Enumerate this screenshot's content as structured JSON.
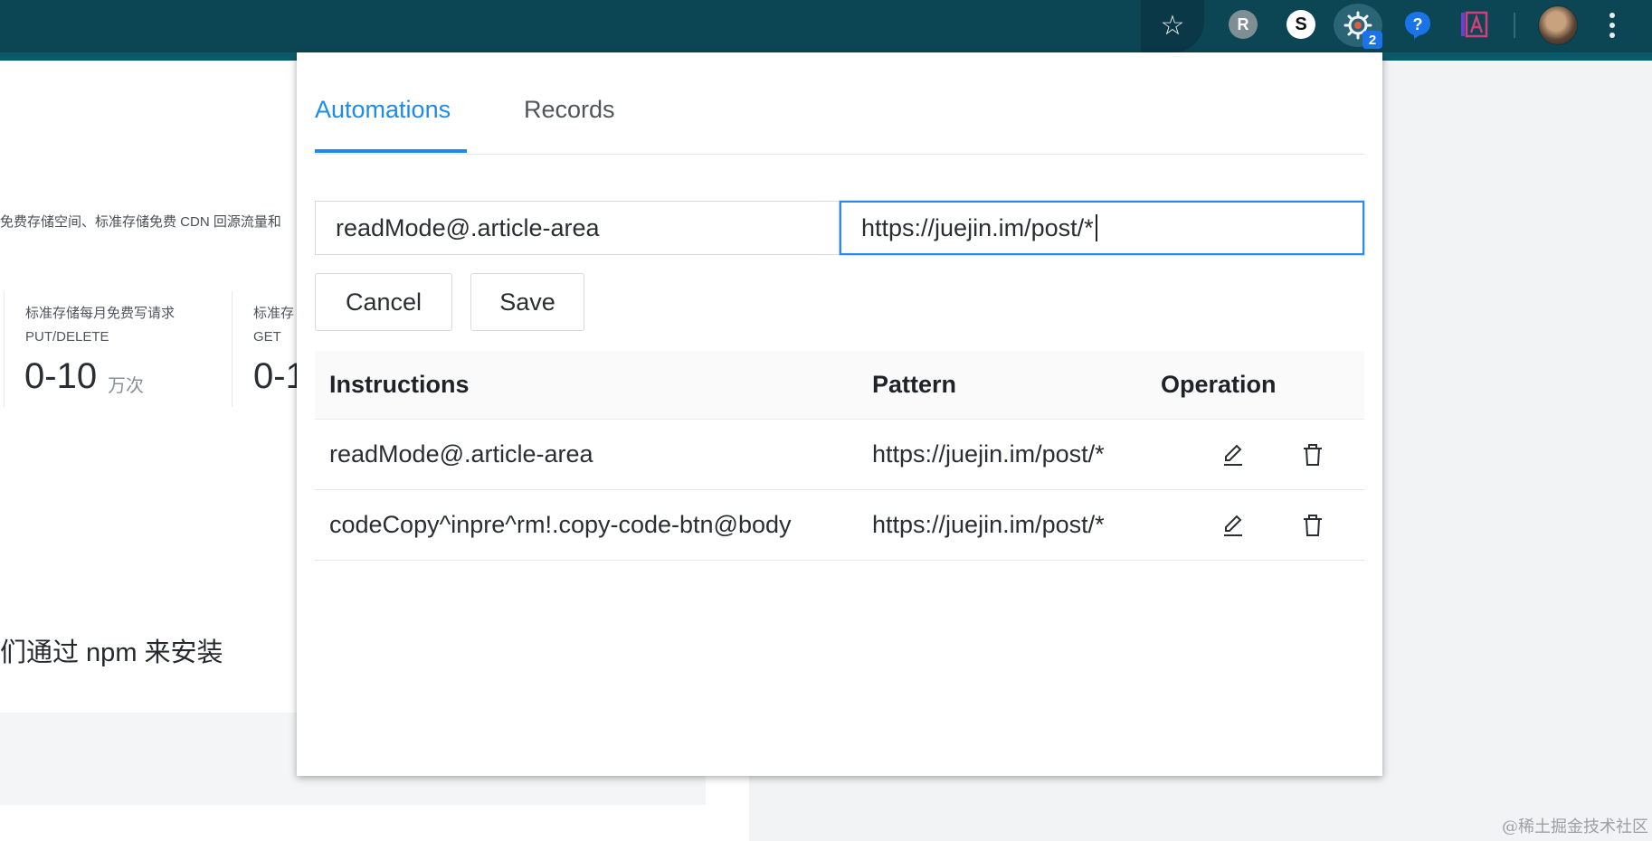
{
  "toolbar": {
    "star_icon": "star-icon",
    "ext_r_label": "R",
    "ext_s_label": "S",
    "ext_badge": "2",
    "help_label": "?"
  },
  "background_page": {
    "description": "免费存储空间、标准存储免费 CDN 回源流量和",
    "cards": [
      {
        "title": "标准存储每月免费写请求",
        "subtitle": "PUT/DELETE",
        "value": "0-10",
        "unit": "万次"
      },
      {
        "title": "标准存",
        "subtitle": "GET",
        "value": "0-1",
        "unit": ""
      }
    ],
    "heading": "们通过 npm 来安装",
    "watermark": "@稀土掘金技术社区"
  },
  "popup": {
    "tabs": [
      {
        "label": "Automations",
        "active": true
      },
      {
        "label": "Records",
        "active": false
      }
    ],
    "form": {
      "instruction_value": "readMode@.article-area",
      "pattern_value": "https://juejin.im/post/*",
      "cancel_label": "Cancel",
      "save_label": "Save"
    },
    "table": {
      "headers": [
        "Instructions",
        "Pattern",
        "Operation"
      ],
      "rows": [
        {
          "instruction": "readMode@.article-area",
          "pattern": "https://juejin.im/post/*"
        },
        {
          "instruction": "codeCopy^inpre^rm!.copy-code-btn@body",
          "pattern": "https://juejin.im/post/*"
        }
      ]
    },
    "accent_color": "#1d8ce8"
  }
}
